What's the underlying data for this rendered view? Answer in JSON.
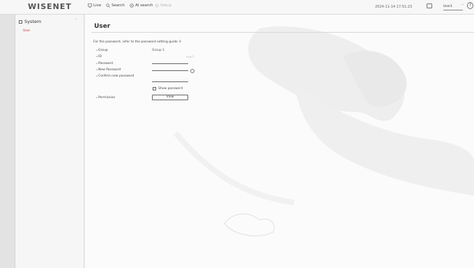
{
  "header": {
    "logo": "WISENET",
    "nav": [
      {
        "label": "Live",
        "icon": "monitor-icon",
        "enabled": true
      },
      {
        "label": "Search",
        "icon": "search-icon",
        "enabled": true
      },
      {
        "label": "AI search",
        "icon": "ai-search-icon",
        "enabled": true
      },
      {
        "label": "Setup",
        "icon": "gear-icon",
        "enabled": false
      }
    ],
    "datetime": "2024-11-14 17:51:23",
    "user": "User1",
    "help_icon": "help-icon",
    "storage_icon": "storage-icon"
  },
  "sidebar": {
    "section": "System",
    "item": "User"
  },
  "main": {
    "title": "User",
    "note": "For the password, refer to the password setting guide ①",
    "rows": {
      "group_label": "Group",
      "group_value": "Group 1",
      "id_label": "ID",
      "id_value": "user1",
      "password_label": "Password",
      "new_password_label": "New Password",
      "confirm_label": "Confirm new password",
      "show_password_label": "Show password",
      "permission_label": "Permission",
      "view_button": "View"
    }
  }
}
